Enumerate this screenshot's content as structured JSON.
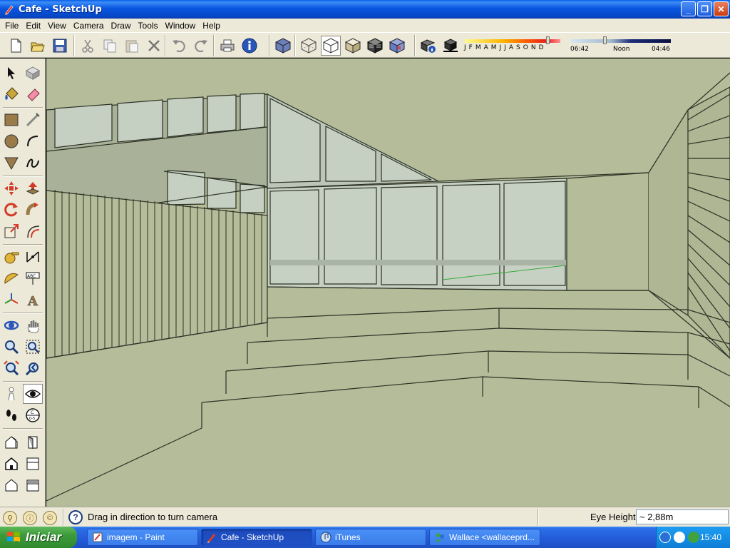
{
  "window": {
    "title": "Cafe - SketchUp",
    "minimize": "_",
    "restore": "❐",
    "close": "✕"
  },
  "menu": [
    "File",
    "Edit",
    "View",
    "Camera",
    "Draw",
    "Tools",
    "Window",
    "Help"
  ],
  "toolbar": {
    "buttons": [
      "new-icon",
      "open-icon",
      "save-icon",
      "cut-icon",
      "copy-icon",
      "paste-icon",
      "erase-icon",
      "undo-icon",
      "redo-icon",
      "print-icon",
      "model-info-icon",
      "iso-view-icon",
      "xray-icon",
      "wireframe-icon",
      "hidden-line-icon",
      "shaded-icon",
      "textured-icon",
      "monochrome-icon",
      "shadow-settings-icon",
      "display-shadows-icon"
    ],
    "pressed": "wireframe-icon"
  },
  "shadow": {
    "months": [
      "J",
      "F",
      "M",
      "A",
      "M",
      "J",
      "J",
      "A",
      "S",
      "O",
      "N",
      "D"
    ],
    "time_start": "06:42",
    "time_mid": "Noon",
    "time_end": "04:46",
    "colors": {
      "month_track": "#ff6a00",
      "time_track": "#1c2e7a"
    }
  },
  "lefttools": [
    "select-icon",
    "make-component-icon",
    "paint-bucket-icon",
    "eraser-icon",
    "rectangle-icon",
    "line-icon",
    "circle-icon",
    "arc-icon",
    "polygon-icon",
    "freehand-icon",
    "move-icon",
    "push-pull-icon",
    "rotate-icon",
    "follow-me-icon",
    "scale-icon",
    "offset-icon",
    "tape-measure-icon",
    "dimension-icon",
    "protractor-icon",
    "text-icon",
    "axes-icon",
    "3d-text-icon",
    "orbit-icon",
    "pan-icon",
    "zoom-icon",
    "zoom-window-icon",
    "zoom-extents-icon",
    "previous-view-icon",
    "position-camera-icon",
    "look-around-icon",
    "walk-icon",
    "section-plane-icon",
    "iso-view-icon",
    "front-view-icon",
    "top-view-icon",
    "right-view-icon",
    "left-view-icon",
    "back-view-icon"
  ],
  "status": {
    "message": "Drag in direction to turn camera",
    "vcb_label": "Eye Height",
    "vcb_value": "~ 2,88m"
  },
  "taskbar": {
    "start": "Iniciar",
    "tasks": [
      {
        "label": "imagem - Paint",
        "active": false
      },
      {
        "label": "Cafe - SketchUp",
        "active": true
      },
      {
        "label": "iTunes",
        "active": false
      },
      {
        "label": "Wallace <wallaceprd...",
        "active": false
      }
    ],
    "clock": "15:40"
  },
  "colors": {
    "viewport_bg": "#b4bc9a",
    "glass": "#c5d0c2",
    "edge": "#2c3024",
    "title_blue": "#0956e0"
  }
}
